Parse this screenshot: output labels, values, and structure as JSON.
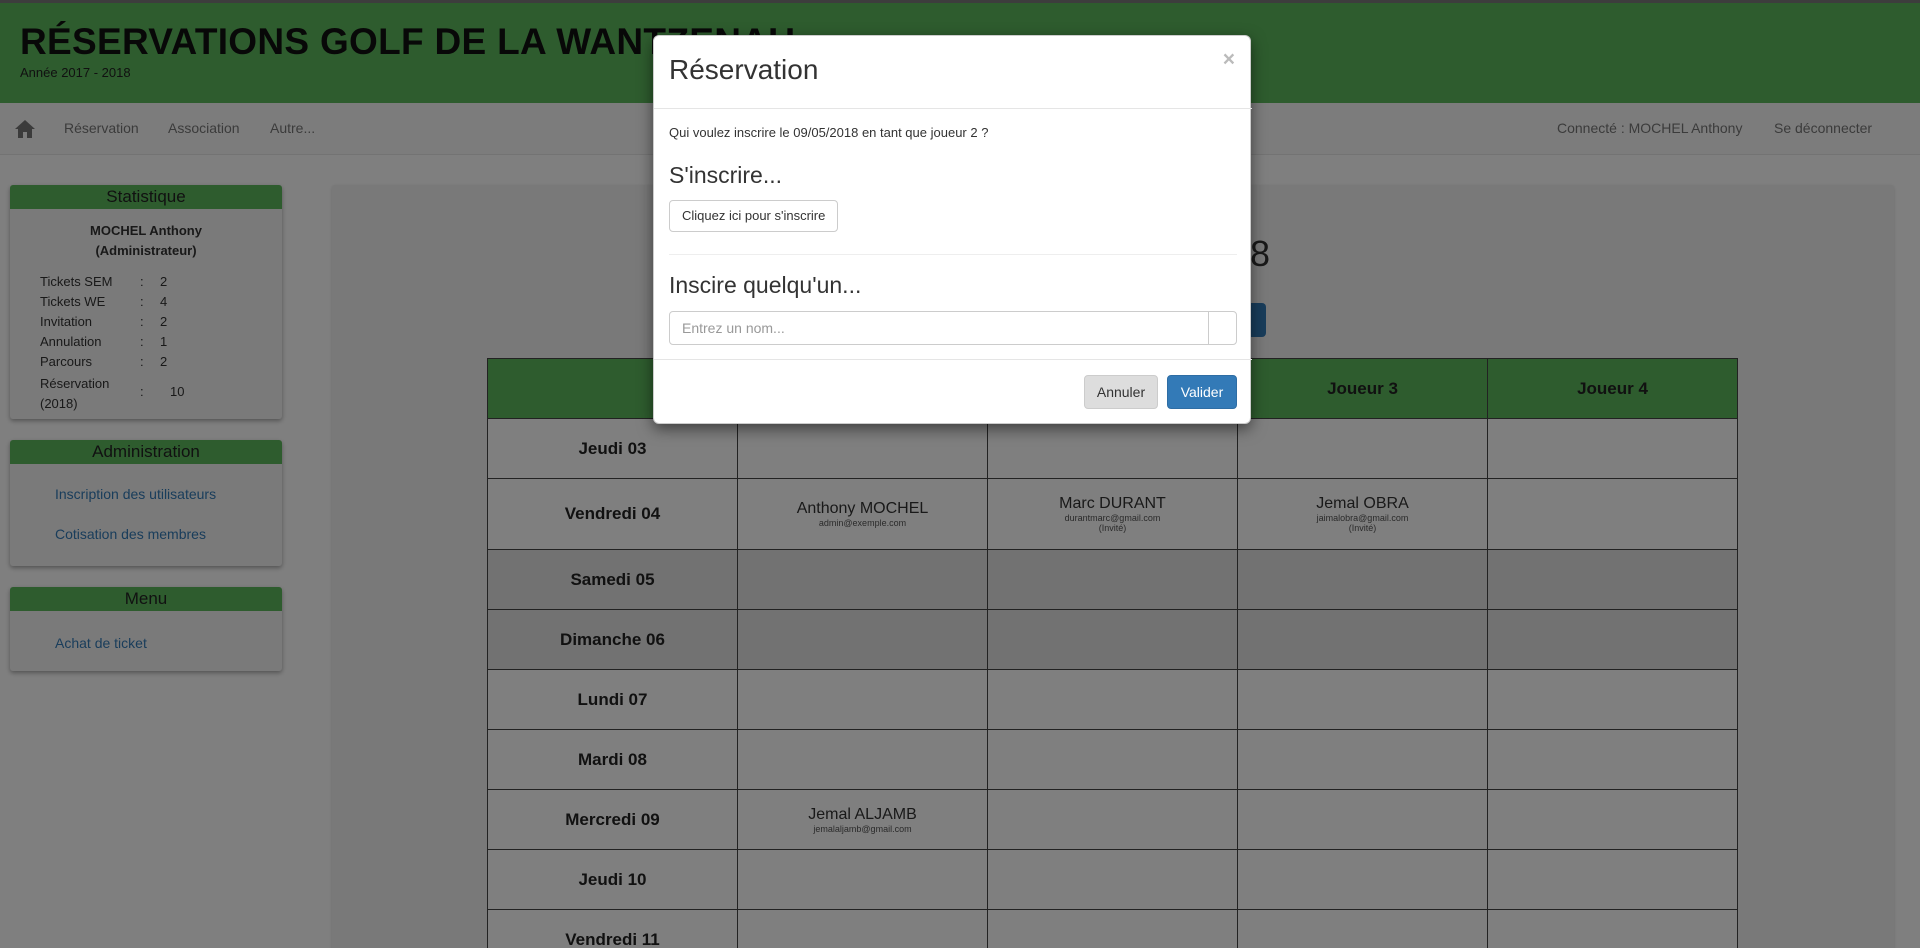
{
  "header": {
    "title": "RÉSERVATIONS GOLF DE LA WANTZENAU",
    "subtitle": "Année 2017 - 2018"
  },
  "nav": {
    "items": [
      "Réservation",
      "Association",
      "Autre..."
    ],
    "connected": "Connecté : MOCHEL Anthony",
    "logout": "Se déconnecter"
  },
  "sidebar": {
    "statistique": {
      "title": "Statistique",
      "name": "MOCHEL Anthony",
      "role": "(Administrateur)",
      "rows": [
        {
          "label": "Tickets SEM",
          "sep": ":",
          "value": "2"
        },
        {
          "label": "Tickets WE",
          "sep": ":",
          "value": "4"
        },
        {
          "label": "Invitation",
          "sep": ":",
          "value": "2"
        },
        {
          "label": "Annulation",
          "sep": ":",
          "value": "1"
        },
        {
          "label": "Parcours",
          "sep": ":",
          "value": "2"
        },
        {
          "label": "Réservation (2018)",
          "sep": ":",
          "value": "10"
        }
      ]
    },
    "administration": {
      "title": "Administration",
      "links": [
        "Inscription des utilisateurs",
        "Cotisation des membres"
      ]
    },
    "menu": {
      "title": "Menu",
      "links": [
        "Achat de ticket"
      ]
    }
  },
  "main": {
    "heading_fragment": "8",
    "table": {
      "headers": [
        "",
        "",
        "",
        "Joueur 3",
        "Joueur 4"
      ],
      "rows": [
        {
          "day": "Jeudi 03",
          "cells": [
            {},
            {},
            {},
            {}
          ]
        },
        {
          "day": "Vendredi 04",
          "cells": [
            {
              "name": "Anthony MOCHEL",
              "email": "admin@exemple.com"
            },
            {
              "name": "Marc DURANT",
              "email": "durantmarc@gmail.com",
              "note": "(Invité)"
            },
            {
              "name": "Jemal OBRA",
              "email": "jaimalobra@gmail.com",
              "note": "(Invité)"
            },
            {}
          ]
        },
        {
          "day": "Samedi 05",
          "cells": [
            {},
            {},
            {},
            {}
          ],
          "weekend": true
        },
        {
          "day": "Dimanche 06",
          "cells": [
            {},
            {},
            {},
            {}
          ],
          "weekend": true
        },
        {
          "day": "Lundi 07",
          "cells": [
            {},
            {},
            {},
            {}
          ]
        },
        {
          "day": "Mardi 08",
          "cells": [
            {},
            {},
            {},
            {}
          ]
        },
        {
          "day": "Mercredi 09",
          "cells": [
            {
              "name": "Jemal ALJAMB",
              "email": "jemalaljamb@gmail.com"
            },
            {},
            {},
            {}
          ]
        },
        {
          "day": "Jeudi 10",
          "cells": [
            {},
            {},
            {},
            {}
          ]
        },
        {
          "day": "Vendredi 11",
          "cells": [
            {},
            {},
            {},
            {}
          ]
        }
      ]
    }
  },
  "modal": {
    "title": "Réservation",
    "close": "×",
    "question": "Qui voulez inscrire le 09/05/2018 en tant que joueur 2 ?",
    "self_heading": "S'inscrire...",
    "self_button": "Cliquez ici pour s'inscrire",
    "other_heading": "Inscire quelqu'un...",
    "name_placeholder": "Entrez un nom...",
    "cancel": "Annuler",
    "confirm": "Valider"
  },
  "colors": {
    "header_green": "#5cb85c",
    "primary_blue": "#337ab7",
    "link_blue": "#337ab7"
  },
  "icons": {
    "home": "home-icon"
  }
}
